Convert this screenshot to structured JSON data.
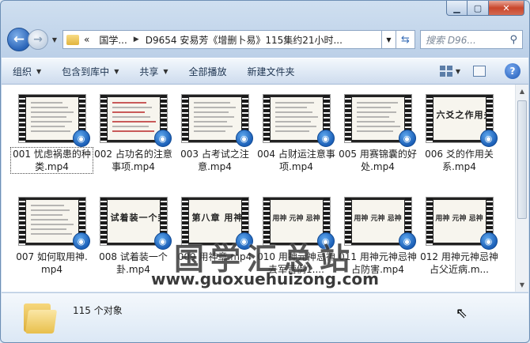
{
  "address": {
    "crumbs": [
      "«",
      "国学...",
      "D9654 安易芳《增删卜易》115集约21小时..."
    ]
  },
  "search": {
    "placeholder": "搜索 D96..."
  },
  "toolbar": {
    "organize": "组织",
    "include_library": "包含到库中",
    "share": "共享",
    "play_all": "全部播放",
    "new_folder": "新建文件夹"
  },
  "watermark": {
    "title": "国学汇总站",
    "url": "www.guoxuehuizong.com"
  },
  "files": [
    {
      "label": "001 忧虑祸患的种类.mp4",
      "frame": "text"
    },
    {
      "label": "002 占功名的注意事项.mp4",
      "frame": "text-red"
    },
    {
      "label": "003 占考试之注意.mp4",
      "frame": "text"
    },
    {
      "label": "004 占财运注意事项.mp4",
      "frame": "text"
    },
    {
      "label": "005 用赛锦囊的好处.mp4",
      "frame": "text"
    },
    {
      "label": "006 爻的作用关系.mp4",
      "frame": "title",
      "frame_text": "六爻之作用关系"
    },
    {
      "label": "007 如何取用神.mp4",
      "frame": "text"
    },
    {
      "label": "008 试着装一个卦.mp4",
      "frame": "title",
      "frame_text": "试着装一个卦"
    },
    {
      "label": "009 用神章.mp4",
      "frame": "title",
      "frame_text": "第八章 用神章"
    },
    {
      "label": "010 用神元神忌神 去军营例1....",
      "frame": "cal",
      "frame_text": "用神 元神 忌神"
    },
    {
      "label": "011 用神元神忌神 占防害.mp4",
      "frame": "cal",
      "frame_text": "用神 元神 忌神"
    },
    {
      "label": "012 用神元神忌神 占父近病.m...",
      "frame": "cal",
      "frame_text": "用神 元神 忌神"
    }
  ],
  "status": {
    "count_text": "115 个对象"
  },
  "icons": {
    "back": "arrow-left-icon",
    "forward": "arrow-right-icon",
    "refresh": "refresh-icon",
    "search": "search-icon",
    "help": "help-icon",
    "views": "views-icon"
  },
  "colors": {
    "accent": "#2a64b8",
    "close": "#c9462c"
  }
}
